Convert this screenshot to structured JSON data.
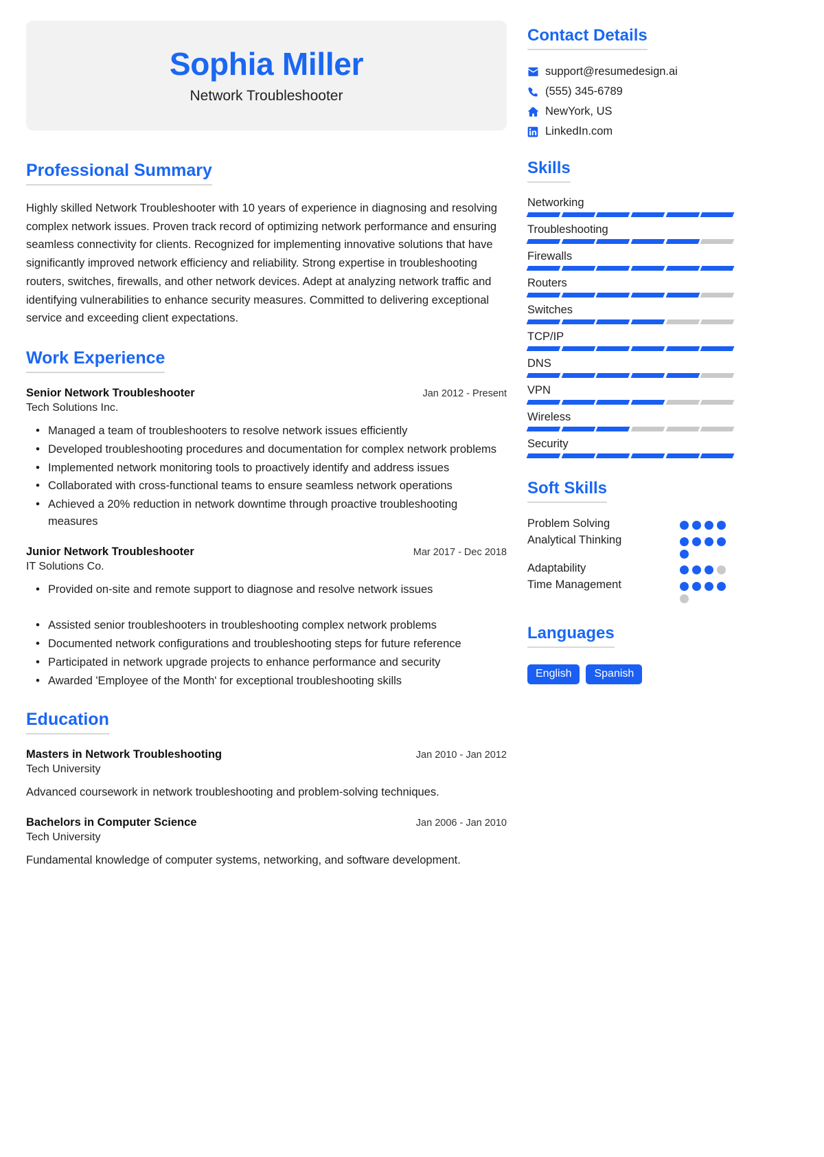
{
  "header": {
    "name": "Sophia Miller",
    "job_title": "Network Troubleshooter",
    "accent_color": "#1a67f2",
    "banner_bg": "#f2f2f2"
  },
  "summary": {
    "heading": "Professional Summary",
    "text": "Highly skilled Network Troubleshooter with 10 years of experience in diagnosing and resolving complex network issues. Proven track record of optimizing network performance and ensuring seamless connectivity for clients. Recognized for implementing innovative solutions that have significantly improved network efficiency and reliability. Strong expertise in troubleshooting routers, switches, firewalls, and other network devices. Adept at analyzing network traffic and identifying vulnerabilities to enhance security measures. Committed to delivering exceptional service and exceeding client expectations."
  },
  "work_experience": {
    "heading": "Work Experience",
    "entries": [
      {
        "title": "Senior Network Troubleshooter",
        "date": "Jan 2012 - Present",
        "organization": "Tech Solutions Inc.",
        "bullets": [
          "Managed a team of troubleshooters to resolve network issues efficiently",
          "Developed troubleshooting procedures and documentation for complex network problems",
          "Implemented network monitoring tools to proactively identify and address issues",
          "Collaborated with cross-functional teams to ensure seamless network operations",
          "Achieved a 20% reduction in network downtime through proactive troubleshooting measures"
        ]
      },
      {
        "title": "Junior Network Troubleshooter",
        "date": "Mar 2017 - Dec 2018",
        "organization": "IT Solutions Co.",
        "bullets": [
          "Provided on-site and remote support to diagnose and resolve network issues",
          "Assisted senior troubleshooters in troubleshooting complex network problems",
          "Documented network configurations and troubleshooting steps for future reference",
          "Participated in network upgrade projects to enhance performance and security",
          "Awarded 'Employee of the Month' for exceptional troubleshooting skills"
        ]
      }
    ]
  },
  "education": {
    "heading": "Education",
    "entries": [
      {
        "degree": "Masters in Network Troubleshooting",
        "date": "Jan 2010 - Jan 2012",
        "school": "Tech University",
        "description": "Advanced coursework in network troubleshooting and problem-solving techniques."
      },
      {
        "degree": "Bachelors in Computer Science",
        "date": "Jan 2006 - Jan 2010",
        "school": "Tech University",
        "description": "Fundamental knowledge of computer systems, networking, and software development."
      }
    ]
  },
  "contact": {
    "heading": "Contact Details",
    "items": [
      {
        "icon": "envelope-icon",
        "value": "support@resumedesign.ai"
      },
      {
        "icon": "phone-icon",
        "value": "(555) 345-6789"
      },
      {
        "icon": "home-icon",
        "value": "NewYork, US"
      },
      {
        "icon": "linkedin-icon",
        "value": "LinkedIn.com"
      }
    ]
  },
  "skills": {
    "heading": "Skills",
    "segments_total": 6,
    "filled_color": "#1a5ff2",
    "empty_color": "#c9c9c9",
    "items": [
      {
        "name": "Networking",
        "filled": 6
      },
      {
        "name": "Troubleshooting",
        "filled": 5
      },
      {
        "name": "Firewalls",
        "filled": 6
      },
      {
        "name": "Routers",
        "filled": 5
      },
      {
        "name": "Switches",
        "filled": 4
      },
      {
        "name": "TCP/IP",
        "filled": 6
      },
      {
        "name": "DNS",
        "filled": 5
      },
      {
        "name": "VPN",
        "filled": 4
      },
      {
        "name": "Wireless",
        "filled": 3
      },
      {
        "name": "Security",
        "filled": 6
      }
    ]
  },
  "soft_skills": {
    "heading": "Soft Skills",
    "dots_total": 4,
    "items": [
      {
        "name": "Problem Solving",
        "filled": 4,
        "total": 4
      },
      {
        "name": "Analytical Thinking",
        "filled": 5,
        "total": 5
      },
      {
        "name": "Adaptability",
        "filled": 3,
        "total": 4
      },
      {
        "name": "Time Management",
        "filled": 4,
        "total": 5
      }
    ]
  },
  "languages": {
    "heading": "Languages",
    "items": [
      "English",
      "Spanish"
    ]
  }
}
